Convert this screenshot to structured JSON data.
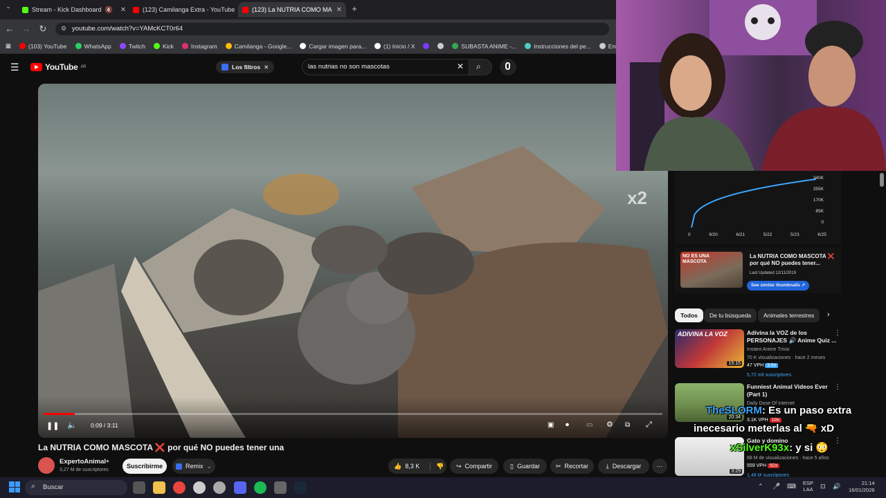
{
  "tabs": [
    {
      "label": "Stream - Kick Dashboard",
      "fav_color": "#53fc18"
    },
    {
      "label": "(123) Camilanga Extra - YouTube",
      "fav_color": "#ff0000"
    },
    {
      "label": "(123) La NUTRIA COMO MA",
      "fav_color": "#ff0000"
    }
  ],
  "new_tab": "+",
  "omnibox": {
    "url": "youtube.com/watch?v=YAMcKCT0r64"
  },
  "bookmarks": [
    {
      "label": "(103) YouTube",
      "color": "#ff0000"
    },
    {
      "label": "WhatsApp",
      "color": "#25d366"
    },
    {
      "label": "Twitch",
      "color": "#9146ff"
    },
    {
      "label": "Kick",
      "color": "#53fc18"
    },
    {
      "label": "Instagram",
      "color": "#e1306c"
    },
    {
      "label": "Camilanga - Google...",
      "color": "#fbbc04"
    },
    {
      "label": "Cargar imagen para...",
      "color": "#ffffff"
    },
    {
      "label": "(1) Inicio / X",
      "color": "#ffffff"
    },
    {
      "label": "",
      "color": "#7a3cff"
    },
    {
      "label": "",
      "color": "#cccccc"
    },
    {
      "label": "SUBASTA ANIME -...",
      "color": "#34a853"
    },
    {
      "label": "Instrucciones del pe...",
      "color": "#4ecdc4"
    },
    {
      "label": "Entrega",
      "color": "#cccccc"
    }
  ],
  "youtube": {
    "logo": "YouTube",
    "region": "AR",
    "filters": "Los filtros",
    "search_query": "las nutrias no son mascotas"
  },
  "video": {
    "overlay": "x2",
    "time": "0:09 / 3:11",
    "progress": 0.05,
    "title": "La NUTRIA COMO MASCOTA ❌ por qué NO puedes tener una",
    "channel": "ExpertoAnimal",
    "subs": "3,27 M de suscriptores",
    "subscribe": "Suscribirme",
    "remix": "Remix",
    "likes": "8,3 K",
    "share": "Compartir",
    "save": "Guardar",
    "clip": "Recortar",
    "download": "Descargar"
  },
  "stats_chart": {
    "yticks": [
      "340K",
      "255K",
      "170K",
      "85K",
      "0"
    ],
    "xticks": [
      "0",
      "9/20",
      "6/21",
      "5/22",
      "5/23",
      "6/25"
    ],
    "line_color": "#3ea6ff"
  },
  "thumb_card": {
    "thumb_text": "NO ES UNA MASCOTA",
    "title": "La NUTRIA COMO MASCOTA ❌ por qué NO puedes tener...",
    "updated": "Last Updated 12/11/2019",
    "button": "See similar thumbnails ↗"
  },
  "chips": [
    "Todos",
    "De tu búsqueda",
    "Animales terrestres"
  ],
  "recs": [
    {
      "thumb_text": "ADIVINA LA VOZ",
      "title": "Adivina la VOZ de los PERSONAJES 🔊 Anime Quiz ...",
      "channel": "Instant Anime Trivia",
      "meta": "70 K visualizaciones · hace 2 meses",
      "vph": "47 VPH",
      "mult": "3.6x",
      "extra": "5,72 mil suscriptores",
      "dur": "15:15"
    },
    {
      "title": "Funniest Animal Videos Ever (Part 1)",
      "channel": "Daily Dose Of Internet",
      "meta": "",
      "vph": "3.1K VPH",
      "mult": "10x",
      "dur": "20:34"
    },
    {
      "title": "Gato y domino",
      "channel": "",
      "meta": "68 M de visualizaciones · hace 5 años",
      "vph": "559 VPH",
      "mult": "92x",
      "extra": "1,48 M suscriptores",
      "dur": "3:29"
    }
  ],
  "chat": [
    {
      "user": "TheSLORM",
      "text": ": Es un paso extra"
    },
    {
      "user": "",
      "text": "inecesario meterlas al 🔫 xD"
    },
    {
      "user": "xSilverK93x",
      "text": ": y si 😳"
    }
  ],
  "taskbar": {
    "search": "Buscar",
    "lang": "ESP",
    "lang2": "LAA",
    "time": "21:14",
    "date": "16/01/2026"
  }
}
